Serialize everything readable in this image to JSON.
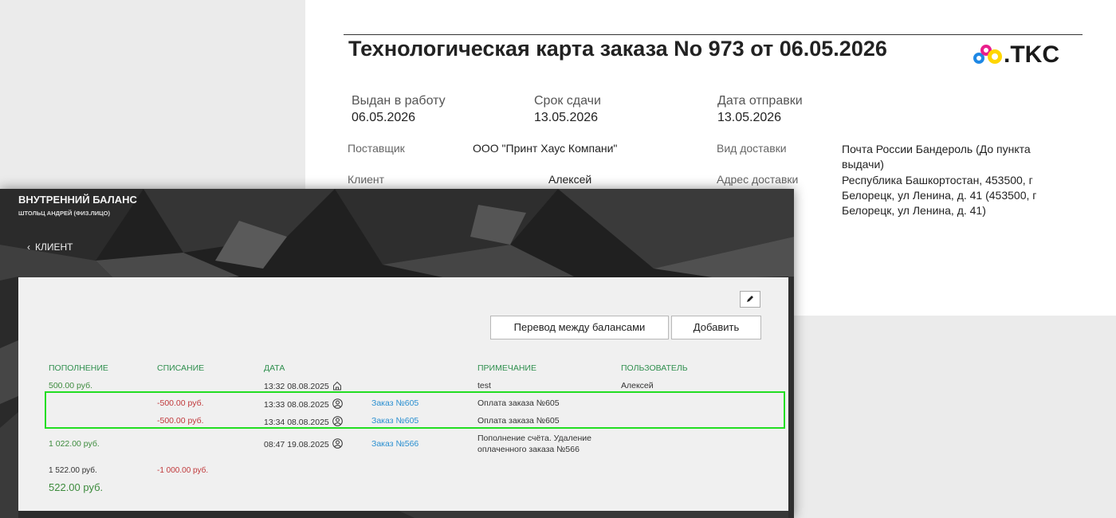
{
  "document": {
    "title": "Технологическая карта заказа No 973 от 06.05.2026",
    "logo_text": ".TKC",
    "dates": [
      {
        "label": "Выдан в работу",
        "value": "06.05.2026"
      },
      {
        "label": "Срок сдачи",
        "value": "13.05.2026"
      },
      {
        "label": "Дата отправки",
        "value": "13.05.2026"
      }
    ],
    "supplier_label": "Поставщик",
    "supplier_value": "ООО \"Принт Хаус Компани\"",
    "client_label": "Клиент",
    "client_value": "Алексей",
    "delivery_type_label": "Вид доставки",
    "delivery_type_value": "Почта России Бандероль (До пункта выдачи)",
    "delivery_address_label": "Адрес доставки",
    "delivery_address_value": "Республика Башкортостан, 453500, г Белорецк, ул Ленина, д. 41 (453500, г Белорецк, ул Ленина, д. 41)"
  },
  "window": {
    "title": "ВНУТРЕННИЙ БАЛАНС",
    "subtitle": "ШТОЛЬЦ АНДРЕЙ (ФИЗ.ЛИЦО)",
    "back_label": "КЛИЕНТ",
    "buttons": {
      "transfer": "Перевод между балансами",
      "add": "Добавить"
    },
    "columns": {
      "deposit": "ПОПОЛНЕНИЕ",
      "withdrawal": "СПИСАНИЕ",
      "date": "ДАТА",
      "note": "ПРИМЕЧАНИЕ",
      "user": "ПОЛЬЗОВАТЕЛЬ"
    },
    "rows": [
      {
        "deposit": "500.00 руб.",
        "withdrawal": "",
        "date": "13:32 08.08.2025",
        "icon": "home-icon",
        "order": "",
        "note": "test",
        "user": "Алексей"
      },
      {
        "deposit": "",
        "withdrawal": "-500.00 руб.",
        "date": "13:33 08.08.2025",
        "icon": "user-icon",
        "order": "Заказ №605",
        "note": "Оплата заказа №605",
        "user": ""
      },
      {
        "deposit": "",
        "withdrawal": "-500.00 руб.",
        "date": "13:34 08.08.2025",
        "icon": "user-icon",
        "order": "Заказ №605",
        "note": "Оплата заказа №605",
        "user": ""
      },
      {
        "deposit": "1 022.00 руб.",
        "withdrawal": "",
        "date": "08:47 19.08.2025",
        "icon": "user-icon",
        "order": "Заказ №566",
        "note": "Пополнение счёта. Удаление оплаченного заказа №566",
        "user": ""
      }
    ],
    "sum_deposit": "1 522.00 руб.",
    "sum_withdrawal": "-1 000.00 руб.",
    "balance": "522.00 руб."
  },
  "colors": {
    "green": "#3d8b3d",
    "red": "#c0393b",
    "link": "#2a8fd0",
    "highlight": "#22dd22"
  }
}
